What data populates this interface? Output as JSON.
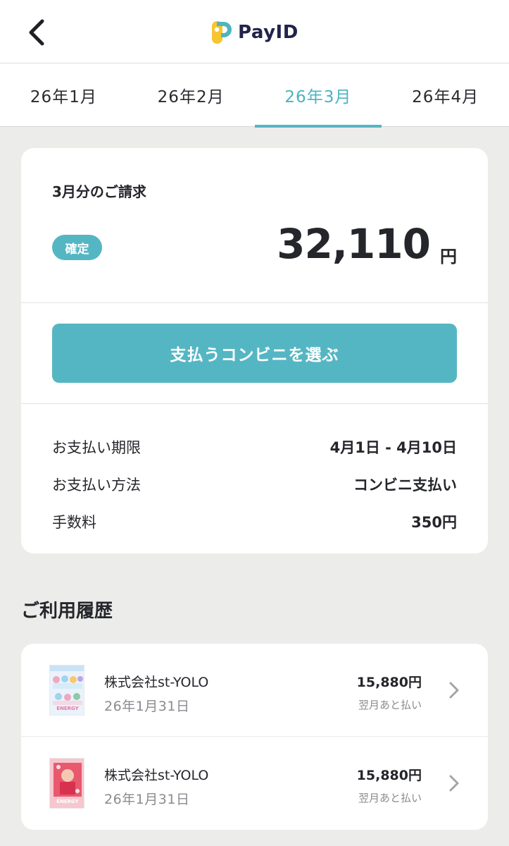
{
  "header": {
    "back_icon": "chevron-left-icon",
    "logo_text": "PayID",
    "logo_colors": {
      "yellow": "#f6c531",
      "teal": "#4fb5be",
      "navy": "#21234a"
    }
  },
  "tabs": [
    {
      "label": "26年1月",
      "active": false
    },
    {
      "label": "26年2月",
      "active": false
    },
    {
      "label": "26年3月",
      "active": true
    },
    {
      "label": "26年4月",
      "active": false
    }
  ],
  "bill": {
    "title": "3月分のご請求",
    "status_badge": "確定",
    "amount": "32,110",
    "amount_unit": "円",
    "pay_button_label": "支払うコンビニを選ぶ",
    "details": [
      {
        "label": "お支払い期限",
        "value": "4月1日 - 4月10日"
      },
      {
        "label": "お支払い方法",
        "value": "コンビニ支払い"
      },
      {
        "label": "手数料",
        "value": "350円"
      }
    ]
  },
  "history": {
    "section_title": "ご利用履歴",
    "items": [
      {
        "merchant": "株式会社st-YOLO",
        "date": "26年1月31日",
        "amount": "15,880円",
        "method": "翌月あと払い",
        "thumb_text": "ENERGY"
      },
      {
        "merchant": "株式会社st-YOLO",
        "date": "26年1月31日",
        "amount": "15,880円",
        "method": "翌月あと払い",
        "thumb_text": "ENERGY"
      }
    ]
  },
  "colors": {
    "accent": "#55b6c3",
    "active_tab_text": "#4ab3c0",
    "background": "#ececea",
    "text_primary": "#25262b",
    "text_secondary": "#8a8b90"
  }
}
